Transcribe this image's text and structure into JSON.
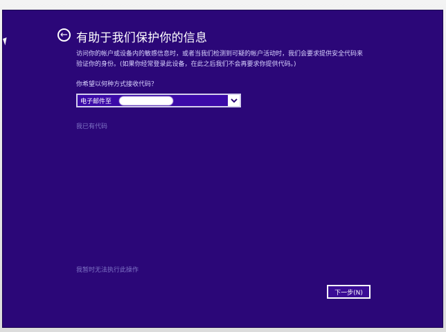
{
  "header": {
    "title": "有助于我们保护你的信息"
  },
  "description": "访问你的帐户或设备内的敏感信息时，或者当我们检测到可疑的帐户活动时，我们会要求提供安全代码来验证你的身份。(如果你经常登录此设备，在此之后我们不会再要求你提供代码。)",
  "question": "你希望以何种方式接收代码？",
  "dropdown": {
    "selected": "电子邮件至"
  },
  "links": {
    "have_code": "我已有代码",
    "cannot_now": "我暂时无法执行此操作"
  },
  "buttons": {
    "next": "下一步(N)"
  },
  "colors": {
    "background": "#2b0778",
    "selected_field": "#3b0aa8",
    "link_text": "#7f74c6",
    "text": "#ffffff"
  },
  "icons": {
    "back": "back-arrow-icon",
    "dropdown": "chevron-down-icon",
    "cursor": "mouse-pointer-icon"
  }
}
